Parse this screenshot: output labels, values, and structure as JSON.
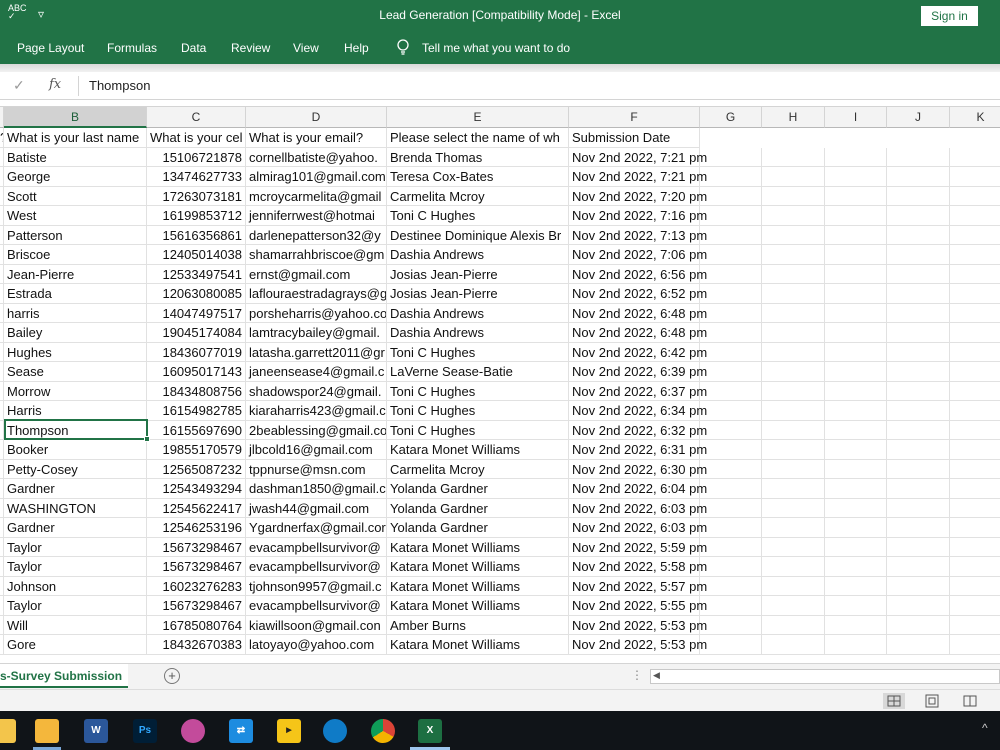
{
  "titlebar": {
    "title": "Lead Generation  [Compatibility Mode]  -  Excel",
    "signin_label": "Sign in",
    "spellcheck_icon": "spellcheck-icon",
    "qat_dropdown_icon": "chevron-down-icon"
  },
  "ribbon": {
    "tabs": [
      "Page Layout",
      "Formulas",
      "Data",
      "Review",
      "View",
      "Help"
    ],
    "tell_me": "Tell me what you want to do"
  },
  "formula_bar": {
    "content": "Thompson"
  },
  "columns": [
    "B",
    "C",
    "D",
    "E",
    "F",
    "G",
    "H",
    "I",
    "J",
    "K"
  ],
  "selected_column": "B",
  "sheet": {
    "header_row": {
      "a_partial": "?",
      "b": "What is your last name",
      "c": "What is your cel",
      "d": "What is your email?",
      "e": "Please select the name of wh",
      "f": "Submission Date"
    },
    "rows": [
      [
        "Batiste",
        "15106721878",
        "cornellbatiste@yahoo.",
        "Brenda Thomas",
        "Nov 2nd 2022, 7:21 pm"
      ],
      [
        "George",
        "13474627733",
        "almirag101@gmail.com",
        "Teresa Cox-Bates",
        "Nov 2nd 2022, 7:21 pm"
      ],
      [
        "Scott",
        "17263073181",
        "mcroycarmelita@gmail",
        "Carmelita Mcroy",
        "Nov 2nd 2022, 7:20 pm"
      ],
      [
        "West",
        "16199853712",
        "jenniferrwest@hotmai",
        "Toni C Hughes",
        "Nov 2nd 2022, 7:16 pm"
      ],
      [
        "Patterson",
        "15616356861",
        "darlenepatterson32@y",
        "Destinee Dominique Alexis Br",
        "Nov 2nd 2022, 7:13 pm"
      ],
      [
        "Briscoe",
        "12405014038",
        "shamarrahbriscoe@gm",
        "Dashia Andrews",
        "Nov 2nd 2022, 7:06 pm"
      ],
      [
        "Jean-Pierre",
        "12533497541",
        "ernst@gmail.com",
        "Josias Jean-Pierre",
        "Nov 2nd 2022, 6:56 pm"
      ],
      [
        "Estrada",
        "12063080085",
        "laflouraestradagrays@g",
        "Josias Jean-Pierre",
        "Nov 2nd 2022, 6:52 pm"
      ],
      [
        "harris",
        "14047497517",
        "porsheharris@yahoo.co",
        "Dashia Andrews",
        "Nov 2nd 2022, 6:48 pm"
      ],
      [
        "Bailey",
        "19045174084",
        "lamtracybailey@gmail.",
        "Dashia Andrews",
        "Nov 2nd 2022, 6:48 pm"
      ],
      [
        "Hughes",
        "18436077019",
        "latasha.garrett2011@gr",
        "Toni C Hughes",
        "Nov 2nd 2022, 6:42 pm"
      ],
      [
        "Sease",
        "16095017143",
        "janeensease4@gmail.c",
        "LaVerne Sease-Batie",
        "Nov 2nd 2022, 6:39 pm"
      ],
      [
        "Morrow",
        "18434808756",
        "shadowspor24@gmail.",
        "Toni C Hughes",
        "Nov 2nd 2022, 6:37 pm"
      ],
      [
        "Harris",
        "16154982785",
        "kiaraharris423@gmail.c",
        "Toni C Hughes",
        "Nov 2nd 2022, 6:34 pm"
      ],
      [
        "Thompson",
        "16155697690",
        "2beablessing@gmail.co",
        "Toni C Hughes",
        "Nov 2nd 2022, 6:32 pm"
      ],
      [
        "Booker",
        "19855170579",
        "jlbcold16@gmail.com",
        "Katara Monet Williams",
        "Nov 2nd 2022, 6:31 pm"
      ],
      [
        "Petty-Cosey",
        "12565087232",
        "tppnurse@msn.com",
        "Carmelita Mcroy",
        "Nov 2nd 2022, 6:30 pm"
      ],
      [
        "Gardner",
        "12543493294",
        "dashman1850@gmail.c",
        "Yolanda Gardner",
        "Nov 2nd 2022, 6:04 pm"
      ],
      [
        "WASHINGTON",
        "12545622417",
        "jwash44@gmail.com",
        "Yolanda Gardner",
        "Nov 2nd 2022, 6:03 pm"
      ],
      [
        "Gardner",
        "12546253196",
        "Ygardnerfax@gmail.cor",
        "Yolanda Gardner",
        "Nov 2nd 2022, 6:03 pm"
      ],
      [
        "Taylor",
        "15673298467",
        "evacampbellsurvivor@",
        "Katara Monet Williams",
        "Nov 2nd 2022, 5:59 pm"
      ],
      [
        "Taylor",
        "15673298467",
        "evacampbellsurvivor@",
        "Katara Monet Williams",
        "Nov 2nd 2022, 5:58 pm"
      ],
      [
        "Johnson",
        "16023276283",
        "tjohnson9957@gmail.c",
        "Katara Monet Williams",
        "Nov 2nd 2022, 5:57 pm"
      ],
      [
        "Taylor",
        "15673298467",
        "evacampbellsurvivor@",
        "Katara Monet Williams",
        "Nov 2nd 2022, 5:55 pm"
      ],
      [
        "Will",
        "16785080764",
        "kiawillsoon@gmail.con",
        "Amber Burns",
        "Nov 2nd 2022, 5:53 pm"
      ],
      [
        "Gore",
        "18432670383",
        "latoyayo@yahoo.com",
        "Katara Monet Williams",
        "Nov 2nd 2022, 5:53 pm"
      ]
    ]
  },
  "sheet_tabs": {
    "active": "s-Survey Submission",
    "add_icon": "plus-circle-icon"
  },
  "statusbar": {
    "views": [
      "normal-view-icon",
      "page-layout-view-icon",
      "page-break-view-icon"
    ]
  },
  "taskbar": {
    "apps": [
      "File Explorer",
      "Word",
      "Ps",
      "Paint",
      "Connect",
      "Player",
      "Edge",
      "Chrome",
      "Excel"
    ]
  },
  "colors": {
    "excel_green": "#217346",
    "taskbar_bg": "#101418"
  }
}
